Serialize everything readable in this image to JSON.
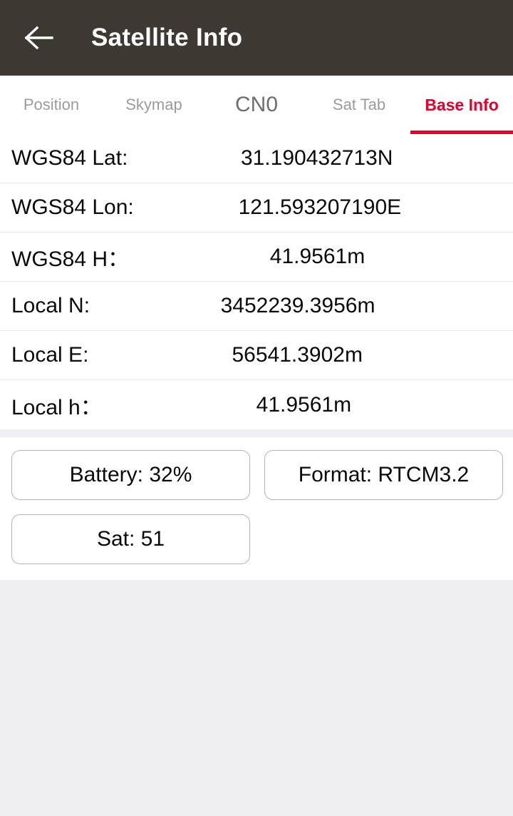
{
  "header": {
    "title": "Satellite Info",
    "back_icon": "arrow-left-icon",
    "background_color": "#3e3833",
    "title_color": "#ffffff"
  },
  "tabs": {
    "active_color": "#e4002b",
    "inactive_color": "#9b9b9b",
    "items": [
      {
        "label": "Position",
        "active": false,
        "emphasis": false
      },
      {
        "label": "Skymap",
        "active": false,
        "emphasis": false
      },
      {
        "label": "CN0",
        "active": false,
        "emphasis": true
      },
      {
        "label": "Sat Tab",
        "active": false,
        "emphasis": false
      },
      {
        "label": "Base Info",
        "active": true,
        "emphasis": false
      }
    ]
  },
  "info": {
    "rows": [
      {
        "label": "WGS84 Lat:",
        "value": "31.190432713N"
      },
      {
        "label": "WGS84 Lon:",
        "value": "121.593207190E"
      },
      {
        "label": "WGS84 H：",
        "value": "41.9561m"
      },
      {
        "label": "Local N:",
        "value": "3452239.3956m"
      },
      {
        "label": "Local E:",
        "value": "56541.3902m"
      },
      {
        "label": "Local h：",
        "value": "41.9561m"
      }
    ]
  },
  "chips": {
    "battery": "Battery: 32%",
    "format": "Format: RTCM3.2",
    "sat": "Sat: 51"
  }
}
